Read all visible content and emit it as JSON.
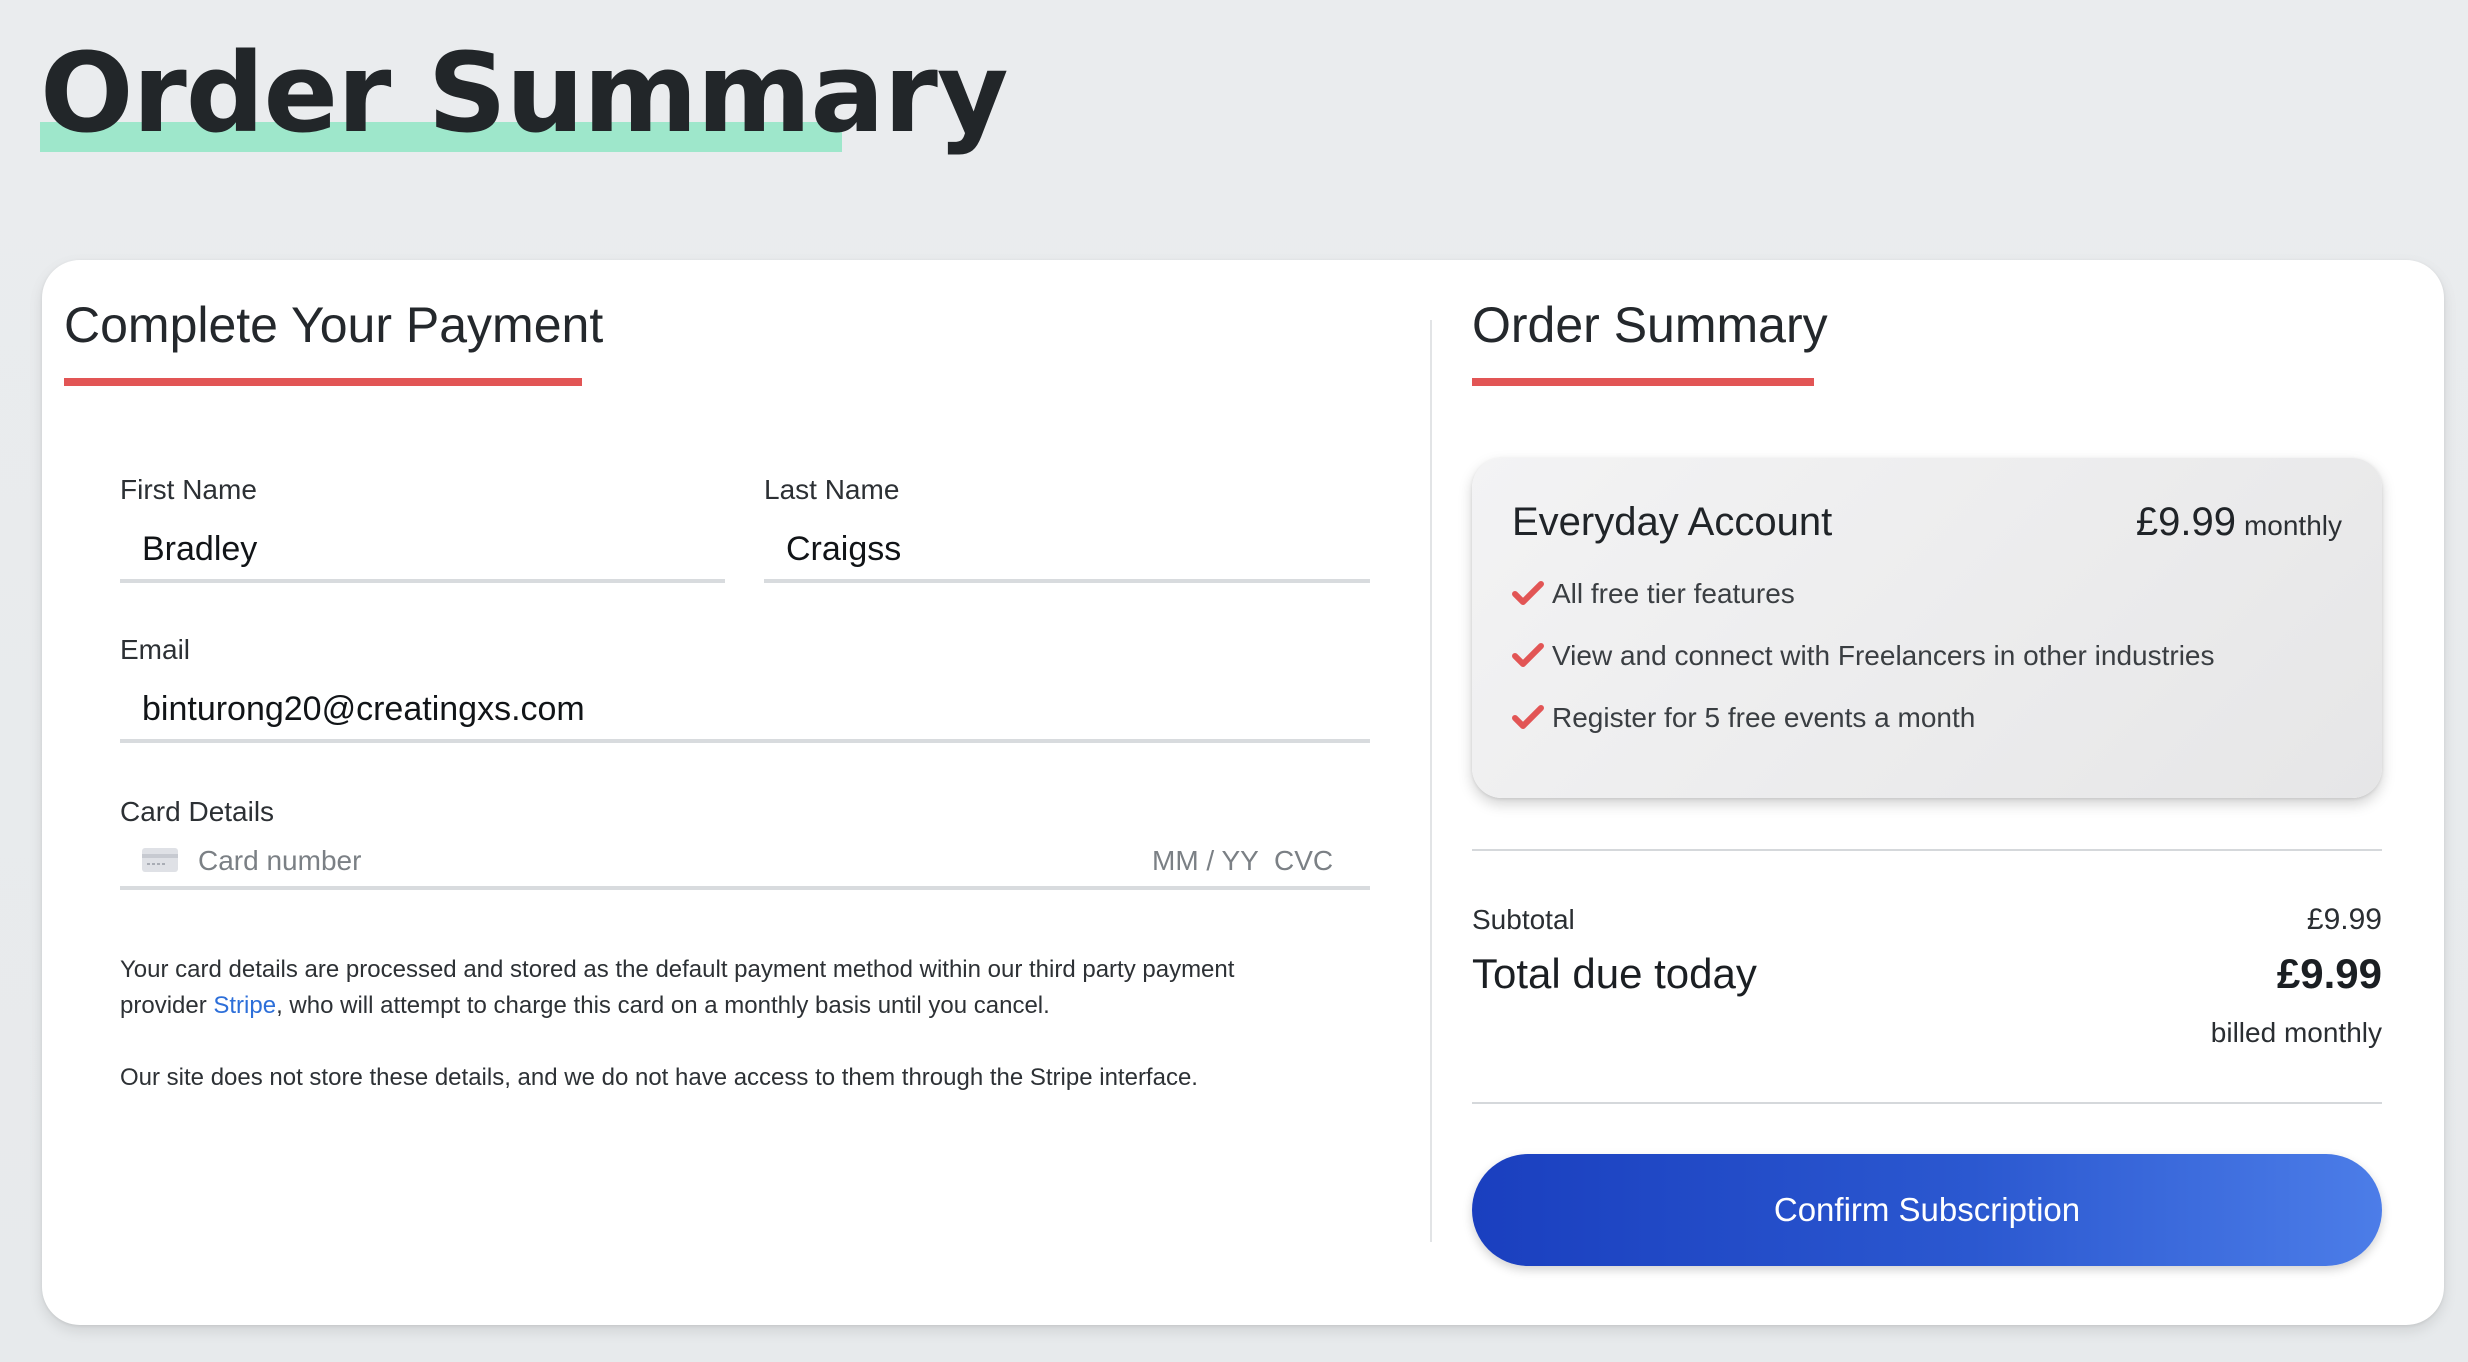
{
  "page": {
    "title": "Order Summary"
  },
  "payment": {
    "title": "Complete Your Payment",
    "first_name": {
      "label": "First Name",
      "value": "Bradley"
    },
    "last_name": {
      "label": "Last Name",
      "value": "Craigss"
    },
    "email": {
      "label": "Email",
      "value": "binturong20@creatingxs.com"
    },
    "card": {
      "label": "Card Details",
      "number_placeholder": "Card number",
      "expiry_placeholder": "MM / YY",
      "cvc_placeholder": "CVC",
      "icon": "credit-card-icon"
    },
    "disclaimer_part1": "Your card details are processed and stored as the default payment method within our third party payment provider ",
    "disclaimer_link": "Stripe",
    "disclaimer_part2": ", who will attempt to charge this card on a monthly basis until you cancel.",
    "privacy_note": "Our site does not store these details, and we do not have access to them through the Stripe interface."
  },
  "summary": {
    "title": "Order Summary",
    "plan": {
      "name": "Everyday Account",
      "price": "£9.99",
      "period": "monthly",
      "features": [
        "All free tier features",
        "View and connect with Freelancers in other industries",
        "Register for 5 free events a month"
      ]
    },
    "subtotal_label": "Subtotal",
    "subtotal_value": "£9.99",
    "total_label": "Total due today",
    "total_value": "£9.99",
    "billing_note": "billed monthly",
    "confirm_label": "Confirm Subscription"
  },
  "colors": {
    "accent_red": "#e25555",
    "heading_highlight": "#9ee7cb",
    "link_blue": "#2d6fd9",
    "button_blue": "#1a3fbf"
  }
}
